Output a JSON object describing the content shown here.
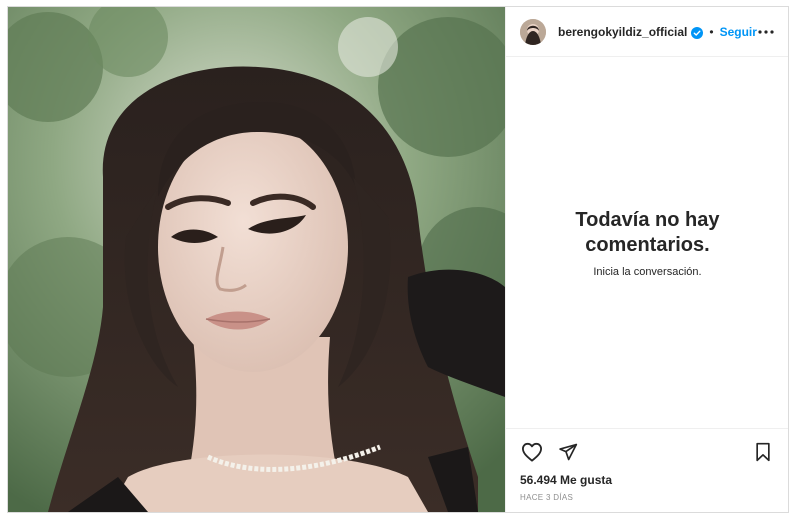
{
  "post": {
    "username": "berengokyildiz_official",
    "separator": "•",
    "follow_label": "Seguir",
    "verified": true
  },
  "comments": {
    "empty_title": "Todavía no hay comentarios.",
    "empty_subtitle": "Inicia la conversación."
  },
  "footer": {
    "likes": "56.494 Me gusta",
    "timestamp": "HACE 3 DÍAS"
  },
  "icons": {
    "more": "more-options-icon",
    "like": "heart-icon",
    "share": "paper-plane-icon",
    "save": "bookmark-icon",
    "verified": "verified-badge-icon"
  },
  "colors": {
    "accent": "#0095f6",
    "text": "#262626",
    "muted": "#8e8e8e",
    "border": "#dbdbdb"
  }
}
